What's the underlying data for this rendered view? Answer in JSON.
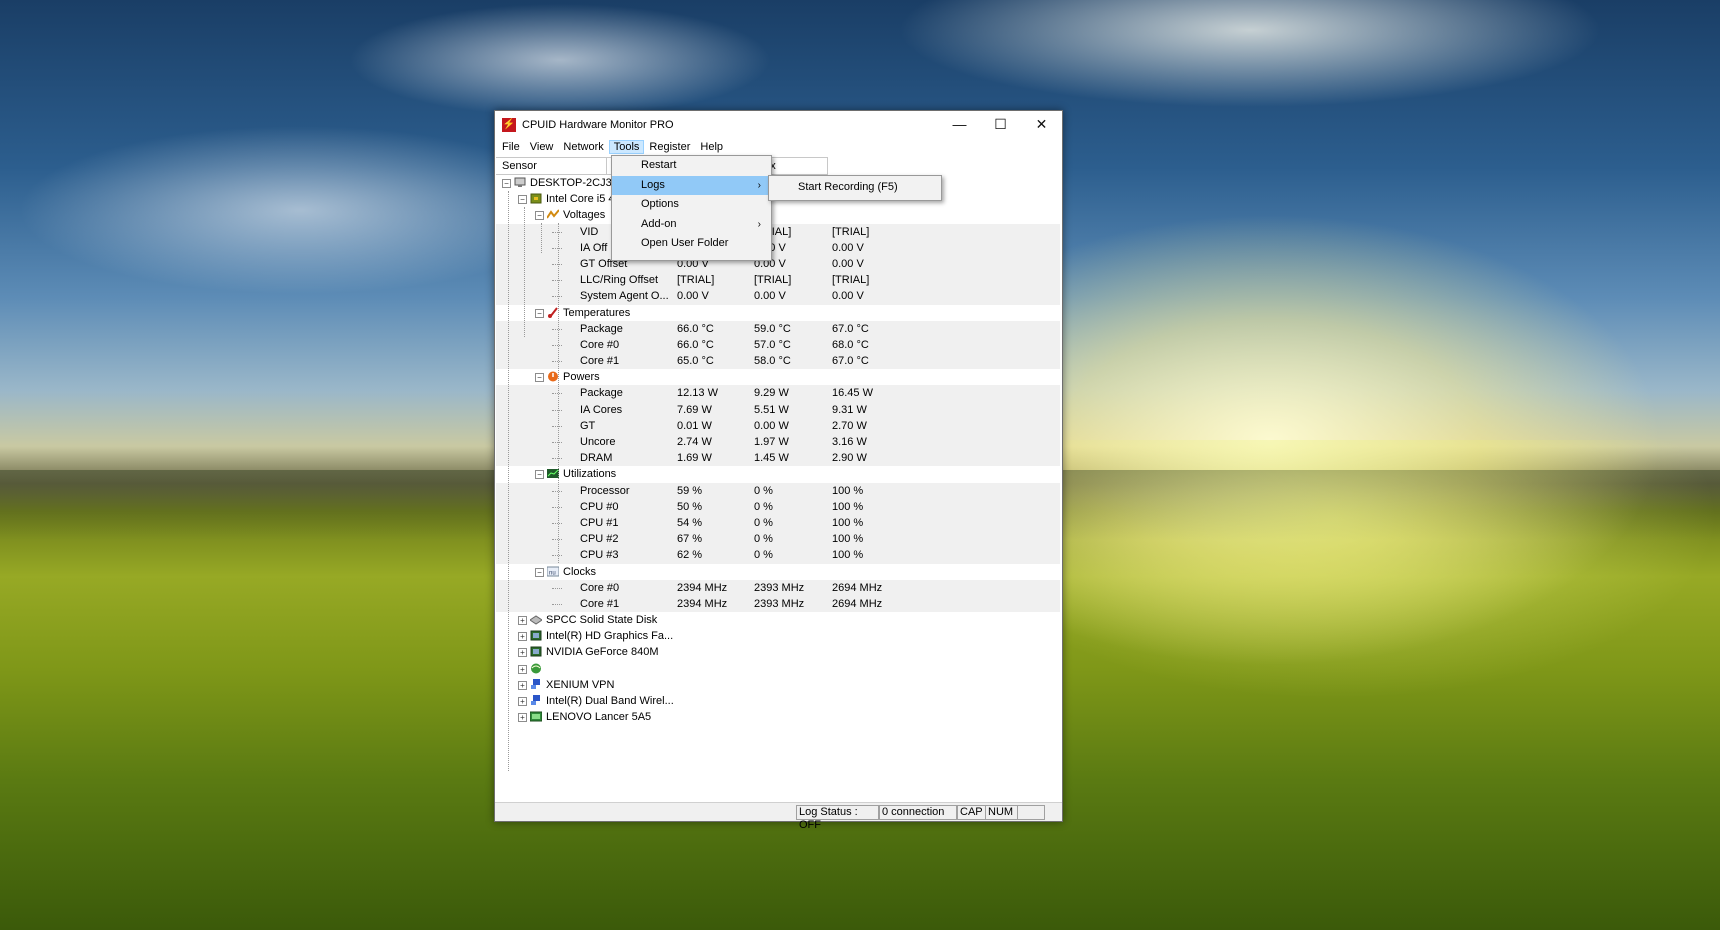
{
  "window": {
    "title": "CPUID Hardware Monitor PRO",
    "icon": "cpuid-app-icon",
    "controls": {
      "minimize": "—",
      "maximize": "☐",
      "close": "✕"
    }
  },
  "menubar": [
    "File",
    "View",
    "Network",
    "Tools",
    "Register",
    "Help"
  ],
  "columns": {
    "sensor": "Sensor",
    "max": "Max"
  },
  "tools_menu": {
    "items": [
      "Restart",
      "Logs",
      "Options",
      "Add-on",
      "Open User Folder"
    ],
    "submenu_arrow": "›"
  },
  "logs_submenu": {
    "item": "Start Recording (F5)"
  },
  "tree": {
    "computer": "DESKTOP-2CJ3IB",
    "cpu": "Intel Core i5 4",
    "groups": {
      "voltages": "Voltages",
      "temperatures": "Temperatures",
      "powers": "Powers",
      "utilizations": "Utilizations",
      "clocks": "Clocks"
    },
    "rows": [
      {
        "name": "VID",
        "value": "",
        "min": "[TRIAL]",
        "max": "[TRIAL]"
      },
      {
        "name": "IA Off",
        "value": "",
        "min": "0.00 V",
        "max": "0.00 V"
      },
      {
        "name": "GT Offset",
        "value": "0.00 V",
        "min": "0.00 V",
        "max": "0.00 V"
      },
      {
        "name": "LLC/Ring Offset",
        "value": "[TRIAL]",
        "min": "[TRIAL]",
        "max": "[TRIAL]"
      },
      {
        "name": "System Agent O...",
        "value": "0.00 V",
        "min": "0.00 V",
        "max": "0.00 V"
      },
      {
        "name": "Package",
        "value": "66.0 °C",
        "min": "59.0 °C",
        "max": "67.0 °C"
      },
      {
        "name": "Core #0",
        "value": "66.0 °C",
        "min": "57.0 °C",
        "max": "68.0 °C"
      },
      {
        "name": "Core #1",
        "value": "65.0 °C",
        "min": "58.0 °C",
        "max": "67.0 °C"
      },
      {
        "name": "Package",
        "value": "12.13 W",
        "min": "9.29 W",
        "max": "16.45 W"
      },
      {
        "name": "IA Cores",
        "value": "7.69 W",
        "min": "5.51 W",
        "max": "9.31 W"
      },
      {
        "name": "GT",
        "value": "0.01 W",
        "min": "0.00 W",
        "max": "2.70 W"
      },
      {
        "name": "Uncore",
        "value": "2.74 W",
        "min": "1.97 W",
        "max": "3.16 W"
      },
      {
        "name": "DRAM",
        "value": "1.69 W",
        "min": "1.45 W",
        "max": "2.90 W"
      },
      {
        "name": "Processor",
        "value": "59 %",
        "min": "0 %",
        "max": "100 %"
      },
      {
        "name": "CPU #0",
        "value": "50 %",
        "min": "0 %",
        "max": "100 %"
      },
      {
        "name": "CPU #1",
        "value": "54 %",
        "min": "0 %",
        "max": "100 %"
      },
      {
        "name": "CPU #2",
        "value": "67 %",
        "min": "0 %",
        "max": "100 %"
      },
      {
        "name": "CPU #3",
        "value": "62 %",
        "min": "0 %",
        "max": "100 %"
      },
      {
        "name": "Core #0",
        "value": "2394 MHz",
        "min": "2393 MHz",
        "max": "2694 MHz"
      },
      {
        "name": "Core #1",
        "value": "2394 MHz",
        "min": "2393 MHz",
        "max": "2694 MHz"
      }
    ],
    "devices": [
      "SPCC Solid State Disk",
      "Intel(R) HD Graphics Fa...",
      "NVIDIA GeForce 840M",
      "",
      "XENIUM VPN",
      "Intel(R) Dual Band Wirel...",
      "LENOVO Lancer 5A5"
    ]
  },
  "status": {
    "log": "Log Status : OFF",
    "connections": "0 connection",
    "cap": "CAP",
    "num": "NUM"
  }
}
